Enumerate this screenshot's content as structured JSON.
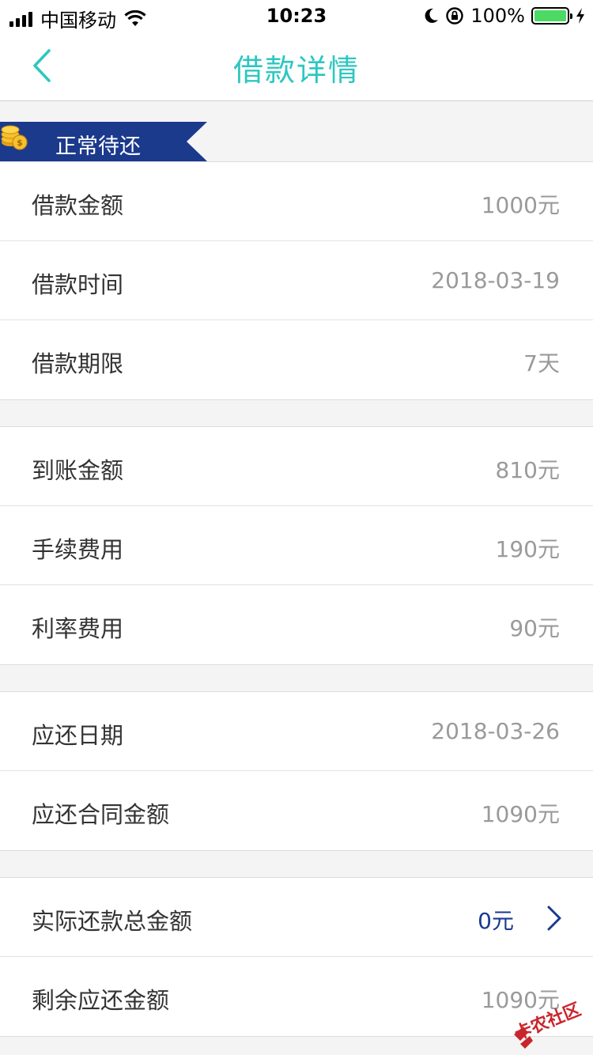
{
  "status_bar": {
    "carrier": "中国移动",
    "time": "10:23",
    "battery": "100%",
    "icons": [
      "signal-icon",
      "wifi-icon",
      "moon-icon",
      "rotation-lock-icon",
      "battery-icon",
      "charging-icon"
    ]
  },
  "nav": {
    "title": "借款详情",
    "back_icon": "chevron-left-icon"
  },
  "banner": {
    "label": "正常待还",
    "icon": "coins-icon",
    "color": "#1b3a8c"
  },
  "groups": [
    {
      "rows": [
        {
          "label": "借款金额",
          "value": "1000元"
        },
        {
          "label": "借款时间",
          "value": "2018-03-19"
        },
        {
          "label": "借款期限",
          "value": "7天"
        }
      ]
    },
    {
      "rows": [
        {
          "label": "到账金额",
          "value": "810元"
        },
        {
          "label": "手续费用",
          "value": "190元"
        },
        {
          "label": "利率费用",
          "value": "90元"
        }
      ]
    },
    {
      "rows": [
        {
          "label": "应还日期",
          "value": "2018-03-26"
        },
        {
          "label": "应还合同金额",
          "value": "1090元"
        }
      ]
    },
    {
      "rows": [
        {
          "label": "实际还款总金额",
          "value": "0元"
        },
        {
          "label": "剩余应还金额",
          "value": "1090元"
        }
      ]
    }
  ],
  "watermark": "卡农社区",
  "colors": {
    "accent_teal": "#2ec7c0",
    "accent_navy": "#1a3a8f",
    "value_gray": "#9a9a9a",
    "battery_green": "#4cd964"
  }
}
